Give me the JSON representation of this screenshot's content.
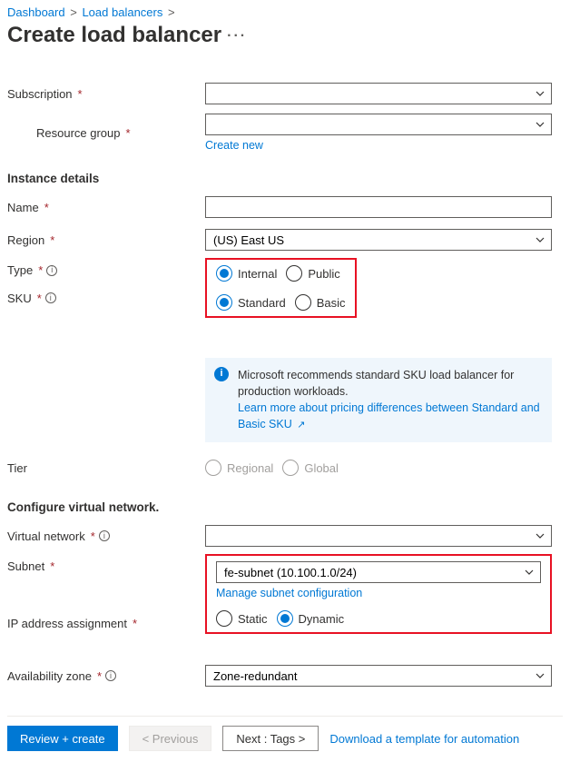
{
  "breadcrumb": {
    "a": "Dashboard",
    "b": "Load balancers"
  },
  "title": "Create load balancer",
  "labels": {
    "subscription": "Subscription",
    "resource_group": "Resource group",
    "create_new": "Create new",
    "instance_details": "Instance details",
    "name": "Name",
    "region": "Region",
    "type": "Type",
    "sku": "SKU",
    "tier": "Tier",
    "configure_vn": "Configure virtual network.",
    "virtual_network": "Virtual network",
    "subnet": "Subnet",
    "manage_subnet": "Manage subnet configuration",
    "ip_assign": "IP address assignment",
    "avail_zone": "Availability zone"
  },
  "values": {
    "region": "(US) East US",
    "subnet": "fe-subnet (10.100.1.0/24)",
    "avail_zone": "Zone-redundant"
  },
  "radios": {
    "type": {
      "a": "Internal",
      "b": "Public"
    },
    "sku": {
      "a": "Standard",
      "b": "Basic"
    },
    "tier": {
      "a": "Regional",
      "b": "Global"
    },
    "ip": {
      "a": "Static",
      "b": "Dynamic"
    }
  },
  "banner": {
    "text": "Microsoft recommends standard SKU load balancer for production workloads.",
    "link": "Learn more about pricing differences between Standard and Basic SKU"
  },
  "footer": {
    "review": "Review + create",
    "prev": "< Previous",
    "next": "Next : Tags >",
    "download": "Download a template for automation"
  }
}
